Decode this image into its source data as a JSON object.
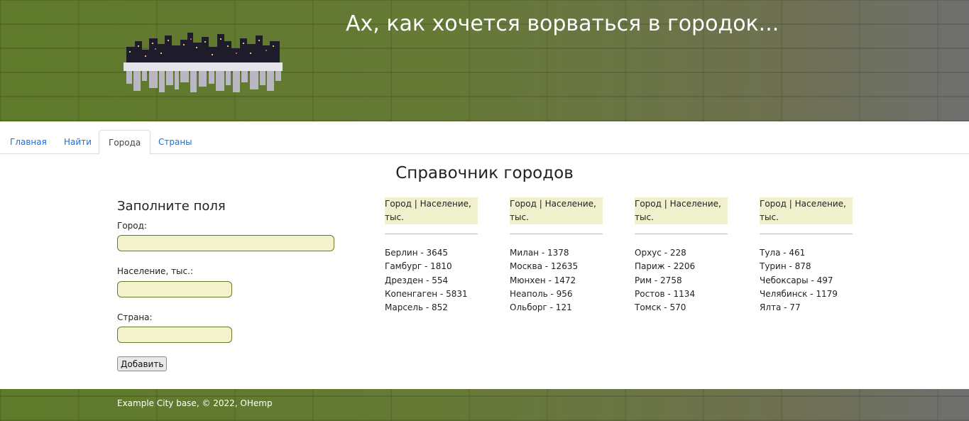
{
  "banner": {
    "title": "Ах, как хочется ворваться в городок..."
  },
  "nav": {
    "tabs": [
      {
        "label": "Главная"
      },
      {
        "label": "Найти"
      },
      {
        "label": "Города"
      },
      {
        "label": "Страны"
      }
    ],
    "active": "Города"
  },
  "page": {
    "heading": "Справочник городов"
  },
  "form": {
    "title": "Заполните поля",
    "city_label": "Город:",
    "city_value": "",
    "population_label": "Население, тыс.:",
    "population_value": "",
    "country_label": "Страна:",
    "country_value": "",
    "submit_label": "Добавить"
  },
  "table": {
    "header": "Город | Население, тыс.",
    "columns": [
      {
        "items": [
          "Берлин - 3645",
          "Гамбург - 1810",
          "Дрезден - 554",
          "Копенгаген - 5831",
          "Марсель - 852"
        ]
      },
      {
        "items": [
          "Милан - 1378",
          "Москва - 12635",
          "Мюнхен - 1472",
          "Неаполь - 956",
          "Ольборг - 121"
        ]
      },
      {
        "items": [
          "Орхус - 228",
          "Париж - 2206",
          "Рим - 2758",
          "Ростов - 1134",
          "Томск - 570"
        ]
      },
      {
        "items": [
          "Тула - 461",
          "Турин - 878",
          "Чебоксары - 497",
          "Челябинск - 1179",
          "Ялта - 77"
        ]
      }
    ]
  },
  "footer": {
    "text": "Example City base, © 2022, OHemp"
  },
  "colors": {
    "banner": "#647a30",
    "input_bg": "#f2f2cc",
    "link": "#1a6fd6",
    "table_header_bg": "#f0f0cc"
  }
}
